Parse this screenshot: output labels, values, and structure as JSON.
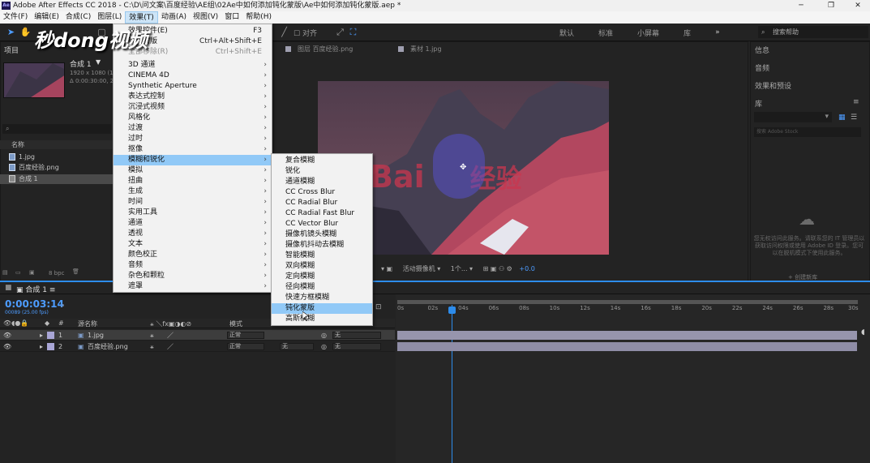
{
  "window": {
    "title": "Adobe After Effects CC 2018 - C:\\D\\问文案\\百度经验\\AE组\\02Ae中如何添加钝化蒙版\\Ae中如何添加钝化蒙版.aep *",
    "logo": "Ae"
  },
  "menubar": [
    "文件(F)",
    "编辑(E)",
    "合成(C)",
    "图层(L)",
    "效果(T)",
    "动画(A)",
    "视图(V)",
    "窗口",
    "帮助(H)"
  ],
  "watermark": "秒dong视频",
  "workspaces": [
    "默认",
    "标准",
    "小屏幕",
    "库"
  ],
  "search_help": "搜索帮助",
  "align_label": "对齐",
  "project": {
    "title": "项目",
    "comp_name": "合成 1",
    "comp_info": [
      "1920 x 1080 (1.00)",
      "Δ 0:00:30:00, 25.0"
    ],
    "name_header": "名称",
    "files": [
      "1.jpg",
      "百度经验.png",
      "合成 1"
    ],
    "bpc": "8 bpc"
  },
  "viewer": {
    "tabs": [
      "图层 百度经验.png",
      "素材 1.jpg"
    ],
    "camera": "活动摄像机",
    "views": "1个...",
    "exposure": "+0.0",
    "logo_text": "Bai",
    "logo_text2": "经验"
  },
  "right_panel": {
    "items": [
      "信息",
      "音频",
      "效果和预设",
      "库"
    ],
    "stock": "搜索 Adobe Stock",
    "message": "您无权访问此服务。请联系您的 IT 管理员以获取访问权限或使用 Adobe ID 登录。您可以在脱机模式下使用此服务。",
    "create_library": "+ 创建新库"
  },
  "timeline": {
    "tab": "合成 1",
    "timecode": "0:00:03:14",
    "fps": "00089 (25.00 fps)",
    "columns": {
      "source": "源名称",
      "mode": "模式"
    },
    "ruler": [
      "0s",
      "02s",
      "04s",
      "06s",
      "08s",
      "10s",
      "12s",
      "14s",
      "16s",
      "18s",
      "20s",
      "22s",
      "24s",
      "26s",
      "28s",
      "30s"
    ],
    "layers": [
      {
        "num": "1",
        "name": "1.jpg",
        "mode": "正常",
        "trkmat": "",
        "parent": "无"
      },
      {
        "num": "2",
        "name": "百度经验.png",
        "mode": "正常",
        "trkmat": "无",
        "parent": "无"
      }
    ]
  },
  "effects_menu": {
    "top_items": [
      {
        "label": "效果控件(E)",
        "shortcut": "F3",
        "disabled": false
      },
      {
        "label": "钝化蒙版",
        "shortcut": "Ctrl+Alt+Shift+E",
        "disabled": false
      },
      {
        "label": "全部移除(R)",
        "shortcut": "Ctrl+Shift+E",
        "disabled": true
      }
    ],
    "categories": [
      "3D 通道",
      "CINEMA 4D",
      "Synthetic Aperture",
      "表达式控制",
      "沉浸式视频",
      "风格化",
      "过渡",
      "过时",
      "抠像",
      "模糊和锐化",
      "模拟",
      "扭曲",
      "生成",
      "时间",
      "实用工具",
      "通道",
      "透视",
      "文本",
      "颜色校正",
      "音频",
      "杂色和颗粒",
      "遮罩"
    ],
    "highlighted": "模糊和锐化"
  },
  "blur_menu": {
    "items": [
      "复合模糊",
      "锐化",
      "通道模糊",
      "CC Cross Blur",
      "CC Radial Blur",
      "CC Radial Fast Blur",
      "CC Vector Blur",
      "摄像机镜头模糊",
      "摄像机抖动去模糊",
      "智能模糊",
      "双向模糊",
      "定向模糊",
      "径向模糊",
      "快速方框模糊",
      "钝化蒙版",
      "高斯模糊"
    ],
    "highlighted": "钝化蒙版"
  },
  "colors": {
    "accent": "#2d8ceb",
    "menu_highlight": "#91c9f7",
    "timecode": "#4d9cff"
  }
}
